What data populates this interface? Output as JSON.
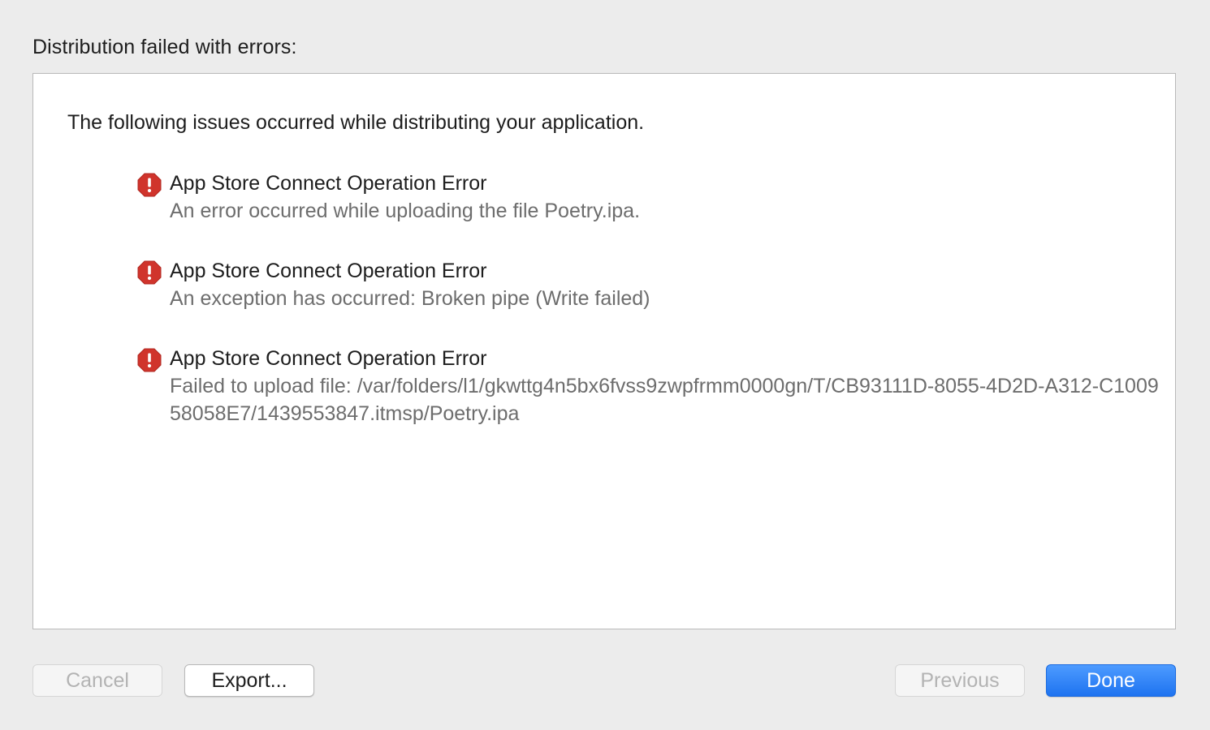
{
  "heading": "Distribution failed with errors:",
  "panel": {
    "intro": "The following issues occurred while distributing your application.",
    "issues": [
      {
        "icon": "error-icon",
        "title": "App Store Connect Operation Error",
        "detail": "An error occurred while uploading the file Poetry.ipa."
      },
      {
        "icon": "error-icon",
        "title": "App Store Connect Operation Error",
        "detail": "An exception has occurred: Broken pipe (Write failed)"
      },
      {
        "icon": "error-icon",
        "title": "App Store Connect Operation Error",
        "detail": "Failed to upload file: /var/folders/l1/gkwttg4n5bx6fvss9zwpfrmm0000gn/T/CB93111D-8055-4D2D-A312-C100958058E7/1439553847.itmsp/Poetry.ipa"
      }
    ]
  },
  "buttons": {
    "cancel": "Cancel",
    "export": "Export...",
    "previous": "Previous",
    "done": "Done"
  },
  "colors": {
    "error_red": "#d0342c",
    "primary_blue": "#1e73f0"
  }
}
